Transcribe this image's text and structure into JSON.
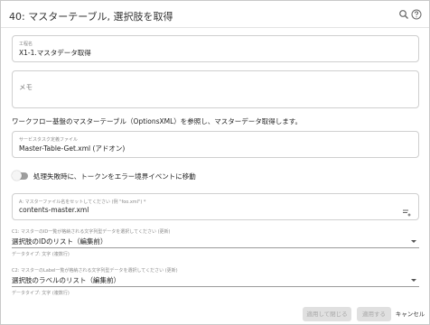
{
  "dialog": {
    "title": "40: マスターテーブル, 選択肢を取得"
  },
  "header": {
    "search_icon": "search-icon",
    "help_icon": "help-icon"
  },
  "fields": {
    "step_name": {
      "label": "工程名",
      "value": "X1-1.マスタデータ取得"
    },
    "memo": {
      "label": "",
      "value": "メモ"
    }
  },
  "description": "ワークフロー基盤のマスターテーブル（OptionsXML）を参照し、マスターデータ取得します。",
  "service_task": {
    "label": "サービスタスク定義ファイル",
    "value": "Master-Table-Get.xml (アドオン)"
  },
  "error_toggle": {
    "label": "処理失敗時に、トークンをエラー境界イベントに移動",
    "checked": false
  },
  "master_file": {
    "label": "A: マスターファイル名をセットしてください (例 \"foo.xml\") *",
    "value": "contents-master.xml",
    "icon": "edit-field-icon"
  },
  "select_c1": {
    "label": "C1: マスターのID一覧が格納される文字列型データを選択してください (更新)",
    "value": "選択肢のIDのリスト（編集前）",
    "helper": "データタイプ: 文字 (複数行)"
  },
  "select_c2": {
    "label": "C2: マスターのLabel一覧が格納される文字列型データを選択してください (更新)",
    "value": "選択肢のラベルのリスト（編集前）",
    "helper": "データタイプ: 文字 (複数行)"
  },
  "footer": {
    "apply_close": "適用して閉じる",
    "apply": "適用する",
    "cancel": "キャンセル"
  }
}
